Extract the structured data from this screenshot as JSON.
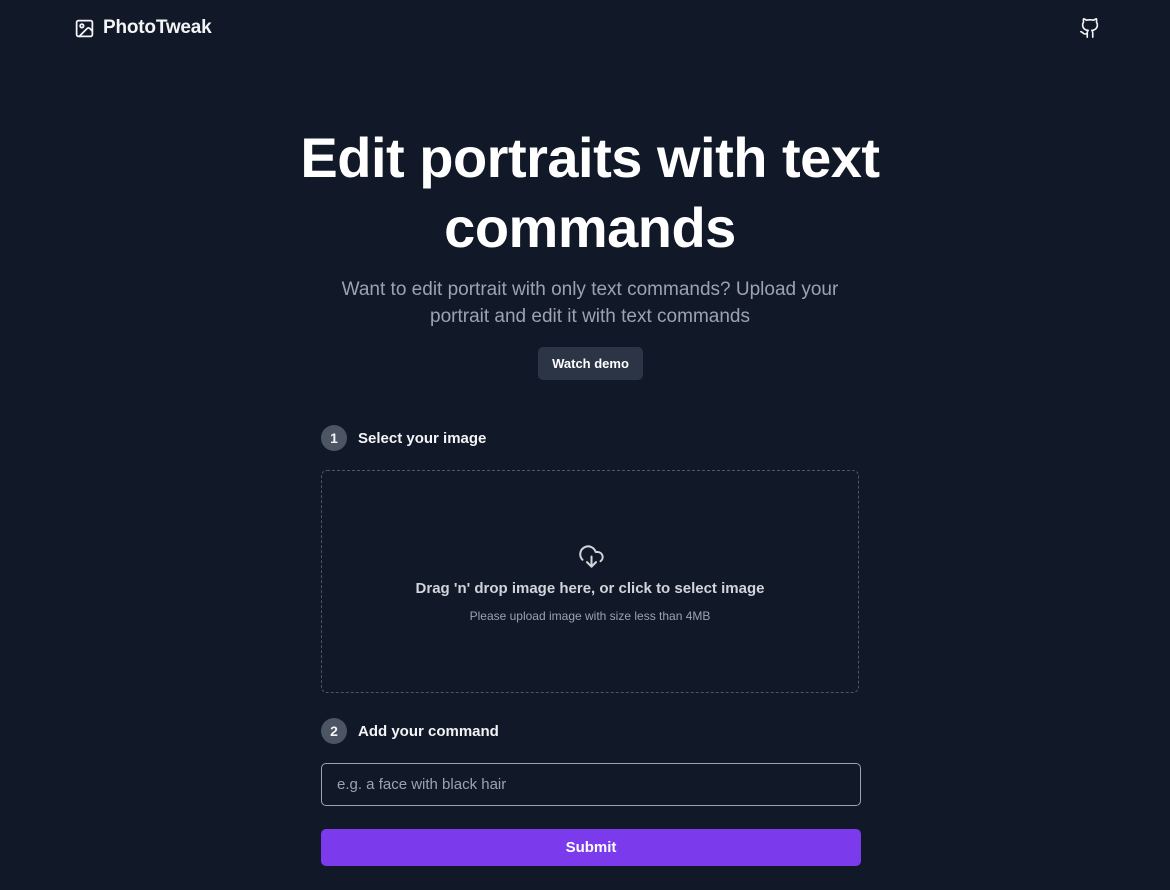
{
  "app": {
    "brand_name": "PhotoTweak",
    "brand_icon": "image-icon",
    "github_icon": "github-icon"
  },
  "hero": {
    "title": "Edit portraits with text commands",
    "subtitle": "Want to edit portrait with only text commands? Upload your portrait and edit it with text commands",
    "demo_button_label": "Watch demo"
  },
  "steps": [
    {
      "number": "1",
      "label": "Select your image"
    },
    {
      "number": "2",
      "label": "Add your command"
    }
  ],
  "dropzone": {
    "icon": "cloud-download-icon",
    "title": "Drag 'n' drop image here, or click to select image",
    "hint": "Please upload image with size less than 4MB"
  },
  "command": {
    "value": "",
    "placeholder": "e.g. a face with black hair"
  },
  "submit_label": "Submit",
  "colors": {
    "background": "#111827",
    "accent": "#7c3aed",
    "muted_text": "#9ca3af",
    "secondary_button": "#2b3545"
  }
}
